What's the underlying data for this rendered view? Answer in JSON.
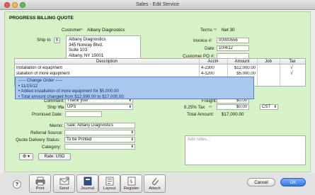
{
  "window": {
    "title": "Sales - Edit Service"
  },
  "form": {
    "heading": "PROGRESS BILLING QUOTE",
    "customer_label": "Customer",
    "customer_value": "Albany Diagnostics",
    "terms_label": "Terms",
    "terms_value": "Net 30",
    "ship_to_label": "Ship to",
    "address": [
      "Albany Diagnostics",
      "345 Norway Blvd.",
      "Suite 103",
      "Albany, NY 15001"
    ],
    "invoice_label": "Invoice #:",
    "invoice_value": "00000556",
    "date_label": "Date:",
    "date_value": "10/4/12",
    "customer_po_label": "Customer PO #:",
    "customer_po_value": ""
  },
  "table": {
    "columns": [
      "Description",
      "Acct#",
      "Amount",
      "Job",
      "Tax"
    ],
    "rows": [
      {
        "description": "Installation of equipment",
        "acct": "4-2300",
        "amount": "$12,000.00",
        "job": "",
        "tax": "√"
      },
      {
        "description": "stallation of more equipment",
        "acct": "4-1200",
        "amount": "$5,000.00",
        "job": "",
        "tax": "√"
      }
    ]
  },
  "change_order": {
    "title": "----- Change Order -----",
    "lines": [
      "11/15/12",
      "Added installation of more equipment for $5,000.00",
      "Total amount changed from $12,990.00 to $17,000.00."
    ]
  },
  "footer_fields": {
    "comment_label": "Comment:",
    "comment_value": "Thank you!",
    "ship_via_label": "Ship Via",
    "ship_via_value": "UPS",
    "promised_date_label": "Promised Date:",
    "promised_date_value": "",
    "freight_label": "Freight:",
    "freight_value": "$0.00",
    "tax_label": "8.25% Tax",
    "tax_value": "$0.00",
    "tax_code": "CST",
    "total_label": "Total Amount:",
    "total_value": "$17,000.00",
    "memo_label": "Memo:",
    "memo_value": "Sale; Albany Diagnostics",
    "referral_label": "Referral Source:",
    "referral_value": "",
    "delivery_label": "Quote Delivery Status:",
    "delivery_value": "To be Printed",
    "category_label": "Category:",
    "category_value": "",
    "notes_placeholder": "Add notes...",
    "rate_label": "Rate: USD"
  },
  "toolbar": {
    "help": "?",
    "buttons": [
      "Print",
      "Send",
      "Journal",
      "Layout",
      "Register",
      "Attach"
    ],
    "cancel": "Cancel",
    "ok": "OK"
  },
  "colors": {
    "panel_bg": "#d7f2c6",
    "popup_bg": "#aac7ee",
    "ok_button": "#2d78e6"
  }
}
